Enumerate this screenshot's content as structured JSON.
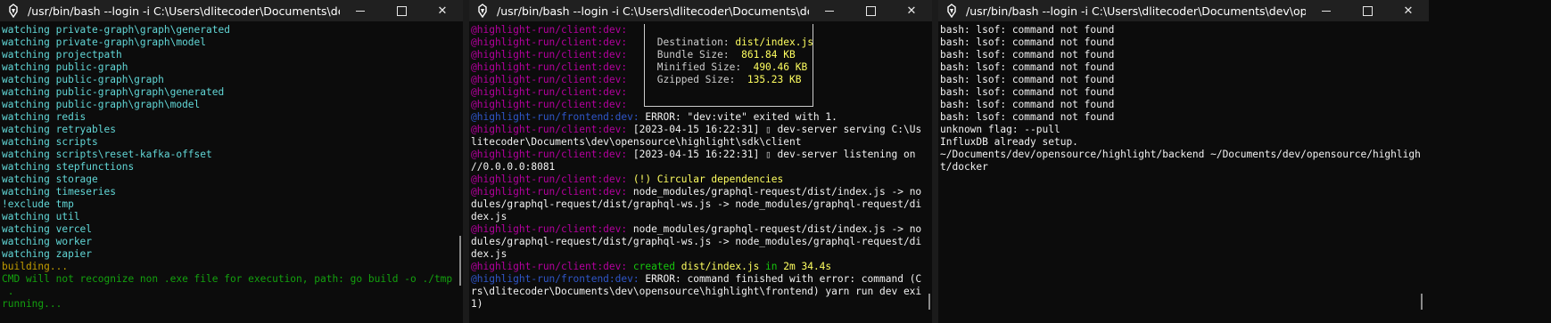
{
  "windows": [
    {
      "title": "/usr/bin/bash --login -i C:\\Users\\dlitecoder\\Documents\\dev\\opensource\\hi...",
      "lines": [
        [
          {
            "t": "watching private-graph\\graph\\generated",
            "c": "c-teal"
          }
        ],
        [
          {
            "t": "watching private-graph\\graph\\model",
            "c": "c-teal"
          }
        ],
        [
          {
            "t": "watching projectpath",
            "c": "c-teal"
          }
        ],
        [
          {
            "t": "watching public-graph",
            "c": "c-teal"
          }
        ],
        [
          {
            "t": "watching public-graph\\graph",
            "c": "c-teal"
          }
        ],
        [
          {
            "t": "watching public-graph\\graph\\generated",
            "c": "c-teal"
          }
        ],
        [
          {
            "t": "watching public-graph\\graph\\model",
            "c": "c-teal"
          }
        ],
        [
          {
            "t": "watching redis",
            "c": "c-teal"
          }
        ],
        [
          {
            "t": "watching retryables",
            "c": "c-teal"
          }
        ],
        [
          {
            "t": "watching scripts",
            "c": "c-teal"
          }
        ],
        [
          {
            "t": "watching scripts\\reset-kafka-offset",
            "c": "c-teal"
          }
        ],
        [
          {
            "t": "watching stepfunctions",
            "c": "c-teal"
          }
        ],
        [
          {
            "t": "watching storage",
            "c": "c-teal"
          }
        ],
        [
          {
            "t": "watching timeseries",
            "c": "c-teal"
          }
        ],
        [
          {
            "t": "!exclude tmp",
            "c": "c-teal"
          }
        ],
        [
          {
            "t": "watching util",
            "c": "c-teal"
          }
        ],
        [
          {
            "t": "watching vercel",
            "c": "c-teal"
          }
        ],
        [
          {
            "t": "watching worker",
            "c": "c-teal"
          }
        ],
        [
          {
            "t": "watching zapier",
            "c": "c-teal"
          }
        ],
        [
          {
            "t": "building...",
            "c": "c-gold"
          }
        ],
        [
          {
            "t": "CMD will not recognize non .exe file for execution, path: go build -o ./tmp/main",
            "c": "c-green"
          }
        ],
        [
          {
            "t": " .",
            "c": "c-green"
          }
        ],
        [
          {
            "t": "running...",
            "c": "c-green"
          }
        ]
      ]
    },
    {
      "title": "/usr/bin/bash --login -i C:\\Users\\dlitecoder\\Documents\\dev\\opensource\\hi...",
      "lines": [
        [
          {
            "t": "@highlight-run/client:dev:",
            "c": "c-mag"
          }
        ],
        [
          {
            "t": "@highlight-run/client:dev:",
            "c": "c-mag"
          },
          {
            "t": "     Destination: ",
            "c": "c-grey"
          },
          {
            "t": "dist/index.js",
            "c": "c-byellow"
          }
        ],
        [
          {
            "t": "@highlight-run/client:dev:",
            "c": "c-mag"
          },
          {
            "t": "     Bundle Size:  ",
            "c": "c-grey"
          },
          {
            "t": "861.84 KB",
            "c": "c-byellow"
          }
        ],
        [
          {
            "t": "@highlight-run/client:dev:",
            "c": "c-mag"
          },
          {
            "t": "     Minified Size:  ",
            "c": "c-grey"
          },
          {
            "t": "490.46 KB",
            "c": "c-byellow"
          }
        ],
        [
          {
            "t": "@highlight-run/client:dev:",
            "c": "c-mag"
          },
          {
            "t": "     Gzipped Size:  ",
            "c": "c-grey"
          },
          {
            "t": "135.23 KB",
            "c": "c-byellow"
          }
        ],
        [
          {
            "t": "@highlight-run/client:dev:",
            "c": "c-mag"
          }
        ],
        [
          {
            "t": "@highlight-run/client:dev:",
            "c": "c-mag"
          }
        ],
        [
          {
            "t": "@highlight-run/frontend:dev:",
            "c": "c-blue"
          },
          {
            "t": " ERROR: \"dev:vite\" exited with 1.",
            "c": "c-white"
          }
        ],
        [
          {
            "t": "@highlight-run/client:dev:",
            "c": "c-mag"
          },
          {
            "t": " [2023-04-15 16:22:31] ",
            "c": "c-white"
          },
          {
            "t": "▯",
            "c": "c-grey"
          },
          {
            "t": " dev-server serving C:\\Users\\d",
            "c": "c-white"
          }
        ],
        [
          {
            "t": "litecoder\\Documents\\dev\\opensource\\highlight\\sdk\\client",
            "c": "c-white"
          }
        ],
        [
          {
            "t": "@highlight-run/client:dev:",
            "c": "c-mag"
          },
          {
            "t": " [2023-04-15 16:22:31] ",
            "c": "c-white"
          },
          {
            "t": "▯",
            "c": "c-grey"
          },
          {
            "t": " dev-server listening on http:",
            "c": "c-white"
          }
        ],
        [
          {
            "t": "//0.0.0.0:8081",
            "c": "c-white"
          }
        ],
        [
          {
            "t": "@highlight-run/client:dev:",
            "c": "c-mag"
          },
          {
            "t": " (!) Circular dependencies",
            "c": "c-byellow"
          }
        ],
        [
          {
            "t": "@highlight-run/client:dev:",
            "c": "c-mag"
          },
          {
            "t": " node_modules/graphql-request/dist/index.js -> node_mo",
            "c": "c-white"
          }
        ],
        [
          {
            "t": "dules/graphql-request/dist/graphql-ws.js -> node_modules/graphql-request/dist/in",
            "c": "c-white"
          }
        ],
        [
          {
            "t": "dex.js",
            "c": "c-white"
          }
        ],
        [
          {
            "t": "@highlight-run/client:dev:",
            "c": "c-mag"
          },
          {
            "t": " node_modules/graphql-request/dist/index.js -> node_mo",
            "c": "c-white"
          }
        ],
        [
          {
            "t": "dules/graphql-request/dist/graphql-ws.js -> node_modules/graphql-request/dist/in",
            "c": "c-white"
          }
        ],
        [
          {
            "t": "dex.js",
            "c": "c-white"
          }
        ],
        [
          {
            "t": "@highlight-run/client:dev:",
            "c": "c-mag"
          },
          {
            "t": " created ",
            "c": "c-lgreen"
          },
          {
            "t": "dist/index.js",
            "c": "c-byellow"
          },
          {
            "t": " in ",
            "c": "c-lgreen"
          },
          {
            "t": "2m 34.4s",
            "c": "c-byellow"
          }
        ],
        [
          {
            "t": "@highlight-run/frontend:dev:",
            "c": "c-blue"
          },
          {
            "t": " ERROR: command finished with error: command (C:\\Use",
            "c": "c-white"
          }
        ],
        [
          {
            "t": "rs\\dlitecoder\\Documents\\dev\\opensource\\highlight\\frontend) yarn run dev exited (",
            "c": "c-white"
          }
        ],
        [
          {
            "t": "1)",
            "c": "c-white"
          }
        ]
      ]
    },
    {
      "title": "/usr/bin/bash --login -i C:\\Users\\dlitecoder\\Documents\\dev\\opensource\\hi...",
      "lines": [
        [
          {
            "t": "bash: lsof: command not found",
            "c": "c-white"
          }
        ],
        [
          {
            "t": "bash: lsof: command not found",
            "c": "c-white"
          }
        ],
        [
          {
            "t": "bash: lsof: command not found",
            "c": "c-white"
          }
        ],
        [
          {
            "t": "bash: lsof: command not found",
            "c": "c-white"
          }
        ],
        [
          {
            "t": "bash: lsof: command not found",
            "c": "c-white"
          }
        ],
        [
          {
            "t": "bash: lsof: command not found",
            "c": "c-white"
          }
        ],
        [
          {
            "t": "bash: lsof: command not found",
            "c": "c-white"
          }
        ],
        [
          {
            "t": "bash: lsof: command not found",
            "c": "c-white"
          }
        ],
        [
          {
            "t": "unknown flag: --pull",
            "c": "c-white"
          }
        ],
        [
          {
            "t": "InfluxDB already setup.",
            "c": "c-white"
          }
        ],
        [
          {
            "t": "~/Documents/dev/opensource/highlight/backend ~/Documents/dev/opensource/highligh",
            "c": "c-white"
          }
        ],
        [
          {
            "t": "t/docker",
            "c": "c-white"
          }
        ]
      ]
    }
  ],
  "controls": {
    "minimize": "—",
    "maximize": "□",
    "close": "✕"
  },
  "colors": {
    "titlebar": "#202020",
    "terminal_bg": "#0c0c0c",
    "teal": "#61d6d6",
    "magenta": "#b4009e",
    "yellow": "#ffff60"
  }
}
